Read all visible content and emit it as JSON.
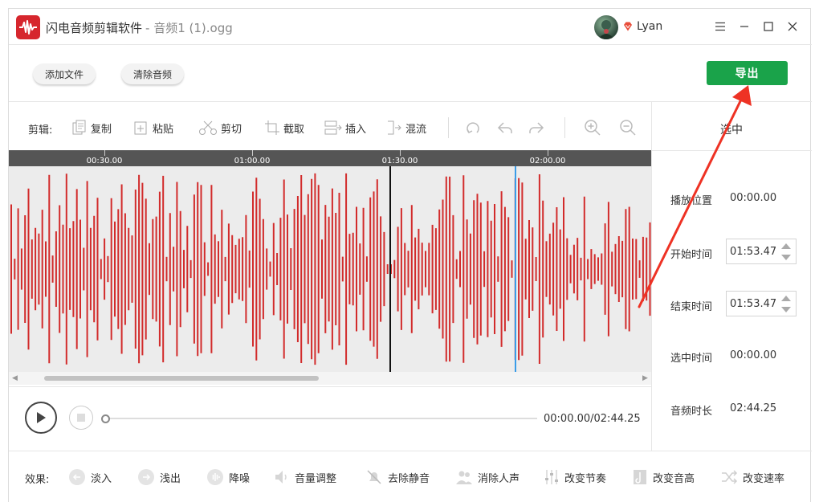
{
  "window": {
    "app_name": "闪电音频剪辑软件",
    "file_name": "- 音频1 (1).ogg",
    "username": "Lyan"
  },
  "toolbar": {
    "add_file": "添加文件",
    "clear_audio": "清除音频",
    "export": "导出"
  },
  "edit_bar": {
    "label": "剪辑:",
    "tools": [
      {
        "label": "复制",
        "icon": "copy-icon"
      },
      {
        "label": "粘贴",
        "icon": "paste-icon"
      },
      {
        "label": "剪切",
        "icon": "scissors-icon"
      },
      {
        "label": "截取",
        "icon": "crop-icon"
      },
      {
        "label": "插入",
        "icon": "insert-icon"
      },
      {
        "label": "混流",
        "icon": "mix-icon"
      }
    ],
    "icon_tools": [
      "reset-icon",
      "undo-icon",
      "redo-icon",
      "zoom-in-icon",
      "zoom-out-icon"
    ]
  },
  "timeline": {
    "ticks": [
      "00:30.00",
      "01:00.00",
      "01:30.00",
      "02:00.00"
    ]
  },
  "player": {
    "time": "00:00.00/02:44.25",
    "progress": 0
  },
  "panel": {
    "title": "选中",
    "play_position_label": "播放位置",
    "play_position": "00:00.00",
    "start_label": "开始时间",
    "start_value": "01:53.47",
    "end_label": "结束时间",
    "end_value": "01:53.47",
    "selected_label": "选中时间",
    "selected_value": "00:00.00",
    "duration_label": "音频时长",
    "duration_value": "02:44.25"
  },
  "effects": {
    "label": "效果:",
    "items": [
      "淡入",
      "浅出",
      "降噪",
      "音量调整",
      "去除静音",
      "消除人声",
      "改变节奏",
      "改变音高",
      "改变速率"
    ]
  },
  "colors": {
    "waveform": "#d22b2b",
    "export_button": "#1aa34a",
    "cursor_line": "#3a9ce8",
    "annotation_arrow": "#ee3224"
  }
}
